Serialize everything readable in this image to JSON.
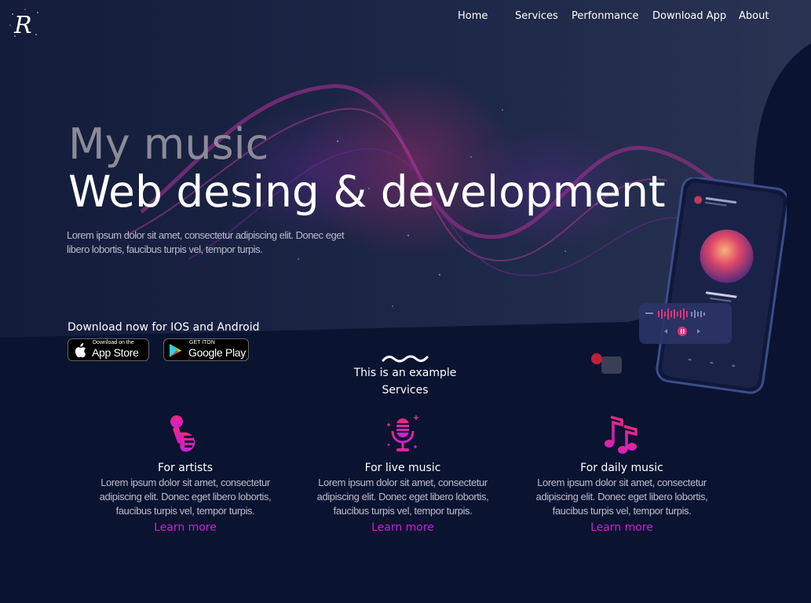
{
  "brand": {
    "logo_letter": "R"
  },
  "nav": {
    "items": [
      {
        "label": "Home"
      },
      {
        "label": "Services"
      },
      {
        "label": "Perfonmance"
      },
      {
        "label": "Download App"
      },
      {
        "label": "About"
      }
    ]
  },
  "hero": {
    "title_line1": "My music",
    "title_line2": "Web desing & development",
    "description": "Lorem ipsum dolor sit amet, consectetur adipiscing elit. Donec eget libero lobortis, faucibus turpis vel, tempor turpis."
  },
  "download": {
    "label": "Download now for IOS and Android",
    "app_store": {
      "small": "Download on the",
      "big": "App Store",
      "icon": "apple-icon"
    },
    "google_play": {
      "small": "GET ITON",
      "big": "Google Play",
      "icon": "google-play-icon"
    }
  },
  "services": {
    "title_line1": "This is an example",
    "title_line2": "Services",
    "cards": [
      {
        "icon": "microphone-hand-icon",
        "title": "For artists",
        "text": "Lorem ipsum dolor sit amet, consectetur adipiscing elit. Donec eget libero lobortis, faucibus turpis vel, tempor turpis.",
        "link": "Learn more"
      },
      {
        "icon": "studio-microphone-icon",
        "title": "For live music",
        "text": "Lorem ipsum dolor sit amet, consectetur adipiscing elit. Donec eget libero lobortis, faucibus turpis vel, tempor turpis.",
        "link": "Learn more"
      },
      {
        "icon": "music-notes-icon",
        "title": "For daily music",
        "text": "Lorem ipsum dolor sit amet, consectetur adipiscing elit. Donec eget libero lobortis, faucibus turpis vel, tempor turpis.",
        "link": "Learn more"
      }
    ]
  },
  "colors": {
    "background": "#0a1330",
    "hero_panel": "#1c2646",
    "accent_pink": "#d21bd8",
    "wave_purple": "#7a2a8a"
  }
}
